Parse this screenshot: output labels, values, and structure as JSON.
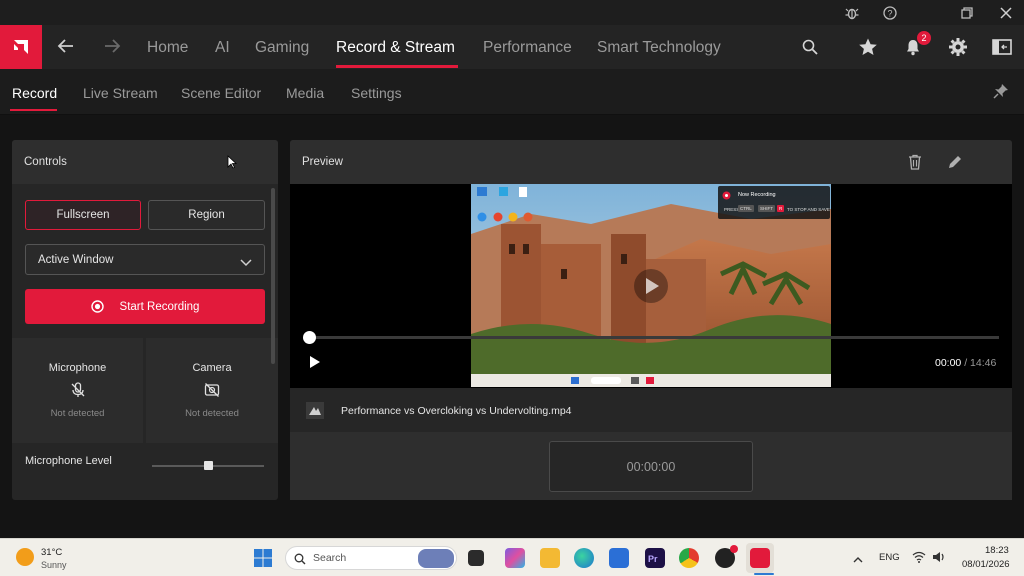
{
  "titlebar": {
    "icons": [
      "bug-report-icon",
      "help-icon",
      "restore-window-icon",
      "close-icon"
    ]
  },
  "nav": {
    "items": [
      {
        "label": "Home"
      },
      {
        "label": "AI"
      },
      {
        "label": "Gaming"
      },
      {
        "label": "Record & Stream"
      },
      {
        "label": "Performance"
      },
      {
        "label": "Smart Technology"
      }
    ],
    "active_index": 3,
    "notification_count": "2",
    "accent": "#e21a3b"
  },
  "subnav": {
    "items": [
      {
        "label": "Record"
      },
      {
        "label": "Live Stream"
      },
      {
        "label": "Scene Editor"
      },
      {
        "label": "Media"
      },
      {
        "label": "Settings"
      }
    ],
    "active_index": 0
  },
  "controls": {
    "title": "Controls",
    "fullscreen_label": "Fullscreen",
    "region_label": "Region",
    "capture_target": "Active Window",
    "start_label": "Start Recording",
    "microphone": {
      "title": "Microphone",
      "status": "Not detected"
    },
    "camera": {
      "title": "Camera",
      "status": "Not detected"
    },
    "mic_level_label": "Microphone Level",
    "mic_level": 0.5
  },
  "preview": {
    "title": "Preview",
    "current_time": "00:00",
    "separator": "/",
    "total_time": "14:46",
    "progress": 0.0,
    "filename": "Performance vs Overcloking vs Undervolting.mp4",
    "clip_time": "00:00:00",
    "overlay_title": "Now Recording",
    "overlay_press": "PRESS",
    "overlay_key1": "CTRL",
    "overlay_key2": "SHIFT",
    "overlay_key3": "R",
    "overlay_stop": "TO STOP AND SAVE"
  },
  "taskbar": {
    "temperature": "31°C",
    "weather": "Sunny",
    "search_placeholder": "Search",
    "language": "ENG",
    "time": "18:23",
    "date": "08/01/2026"
  }
}
